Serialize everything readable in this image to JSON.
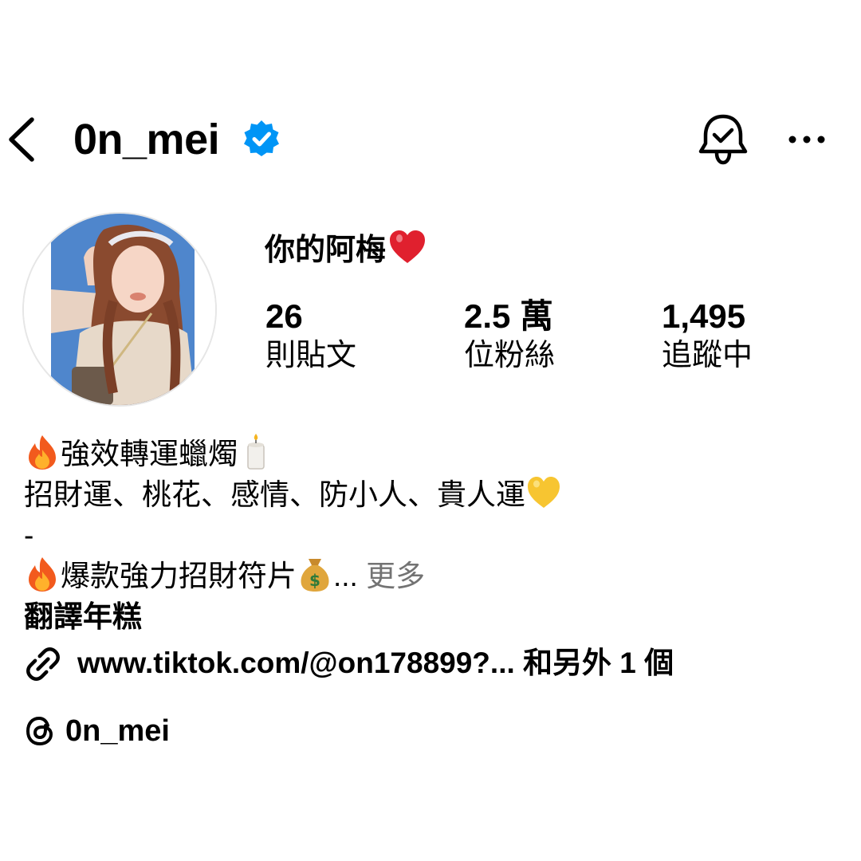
{
  "header": {
    "username": "0n_mei",
    "back_icon": "chevron-left-icon",
    "verified_icon": "verified-badge-icon",
    "notify_icon": "bell-check-icon",
    "more_icon": "ellipsis-icon",
    "accent_color": "#0095f6"
  },
  "profile": {
    "display_name": "你的阿梅",
    "display_name_emoji": "heart-icon",
    "stats": [
      {
        "value": "26",
        "label": "則貼文"
      },
      {
        "value": "2.5 萬",
        "label": "位粉絲"
      },
      {
        "value": "1,495",
        "label": "追蹤中"
      }
    ]
  },
  "bio": {
    "line1": "強效轉運蠟燭",
    "line2": "招財運、桃花、感情、防小人、貴人運",
    "line3": "-",
    "line4": "爆款強力招財符片",
    "line4_ellipsis": "...",
    "more_label": "更多",
    "translate_label": "翻譯年糕"
  },
  "links": {
    "link_text": "www.tiktok.com/@on178899?... 和另外 1 個",
    "link_icon": "link-icon",
    "threads_handle": "0n_mei",
    "threads_icon": "threads-icon",
    "more_color": "#737373"
  }
}
